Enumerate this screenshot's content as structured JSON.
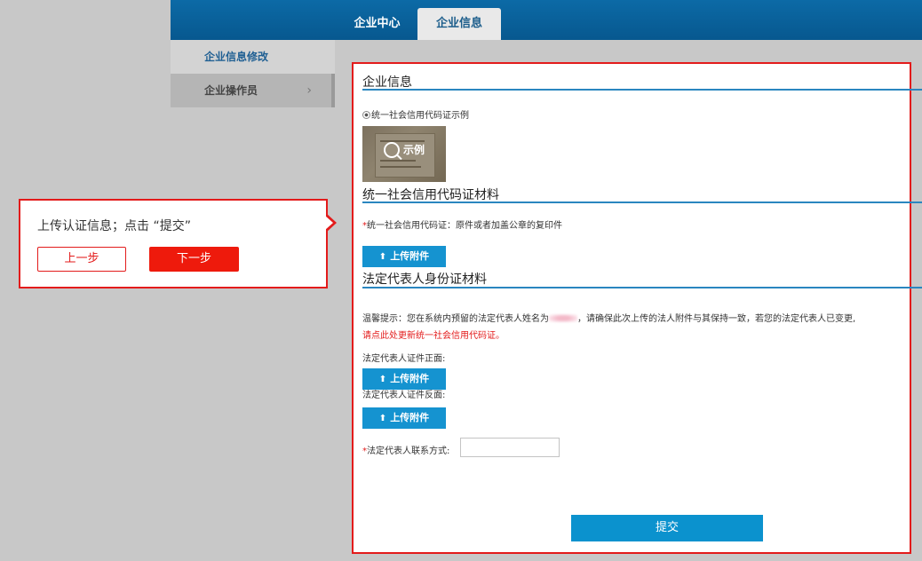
{
  "header": {
    "tabs": [
      {
        "label": "企业中心",
        "active": false
      },
      {
        "label": "企业信息",
        "active": true
      }
    ]
  },
  "sidebar": {
    "items": [
      {
        "label": "企业信息修改",
        "active": true
      },
      {
        "label": "企业操作员",
        "active": false,
        "chevron": "›"
      }
    ]
  },
  "main": {
    "section1_title": "企业信息",
    "radio_label": "统一社会信用代码证示例",
    "example_label": "示例",
    "section2_title": "统一社会信用代码证材料",
    "credit_code_req": "*",
    "credit_code_label": "统一社会信用代码证：原件或者加盖公章的复印件",
    "upload_label": "上传附件",
    "section3_title": "法定代表人身份证材料",
    "notice_prefix": "温馨提示：您在系统内预留的法定代表人姓名为",
    "notice_suffix": "，请确保此次上传的法人附件与其保持一致，若您的法定代表人已变更,",
    "notice_link": "请点此处更新统一社会信用代码证。",
    "id_front_label": "法定代表人证件正面:",
    "id_back_label": "法定代表人证件反面:",
    "contact_req": "*",
    "contact_label": "法定代表人联系方式:",
    "contact_value": "",
    "submit_label": "提交"
  },
  "callout": {
    "text": "上传认证信息；点击 “提交”",
    "prev_label": "上一步",
    "next_label": "下一步"
  },
  "colors": {
    "header_blue": "#07588f",
    "accent_blue": "#1593d0",
    "highlight_red": "#e31b1b"
  }
}
